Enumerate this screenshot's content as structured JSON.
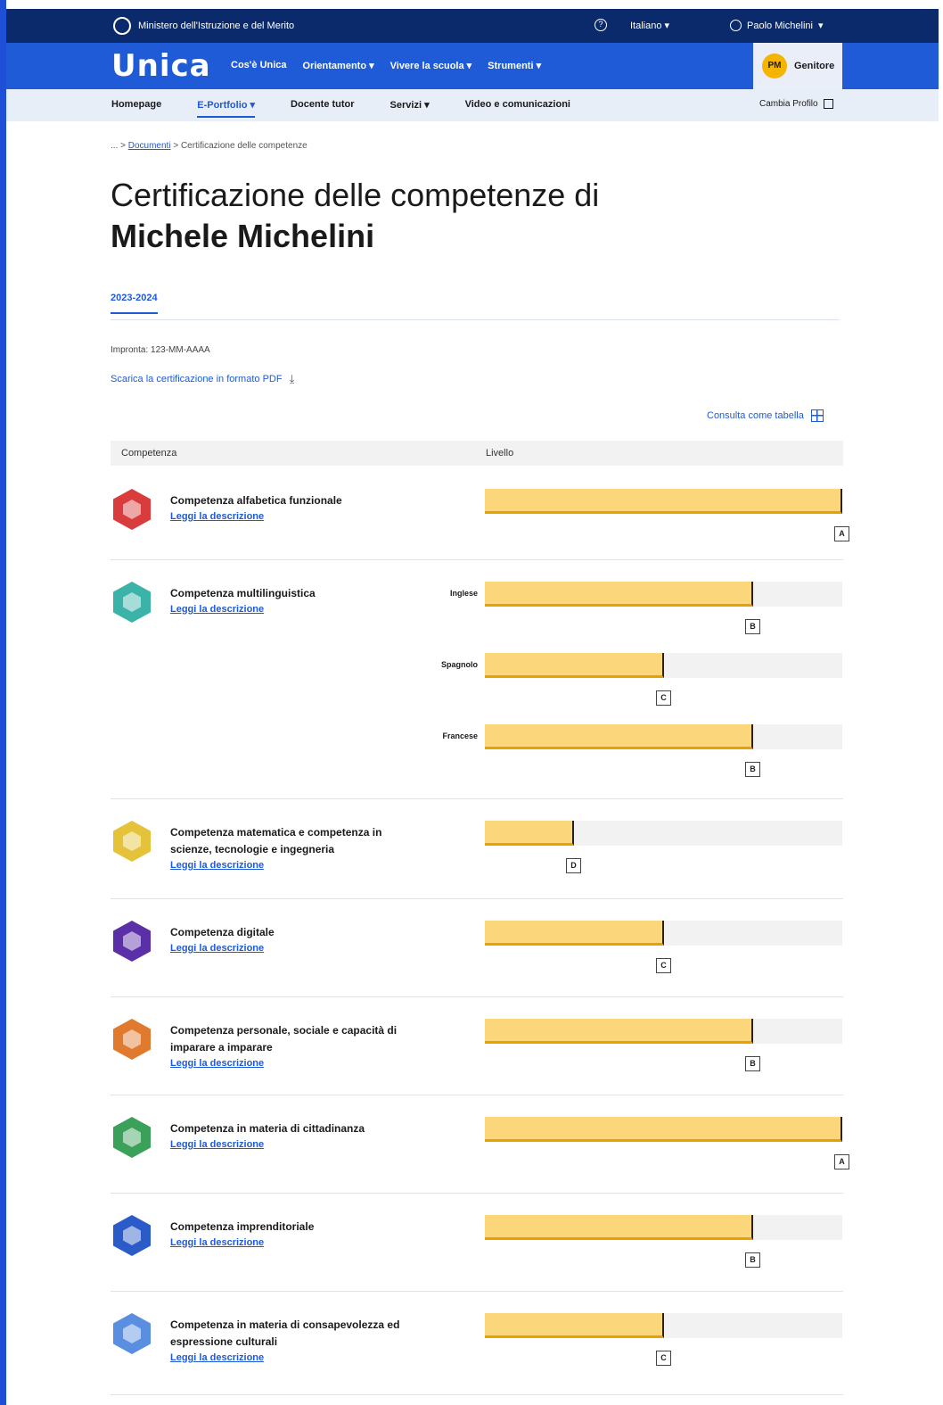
{
  "topbar": {
    "ministry": "Ministero dell'Istruzione e del Merito",
    "help": "?",
    "language": "Italiano",
    "user": "Paolo Michelini"
  },
  "mainnav": {
    "logo": "Unica",
    "links": [
      "Cos'è Unica",
      "Orientamento",
      "Vivere la scuola",
      "Strumenti"
    ],
    "profile": {
      "initials": "PM",
      "role": "Genitore"
    }
  },
  "subnav": {
    "items": [
      "Homepage",
      "E-Portfolio",
      "Docente tutor",
      "Servizi",
      "Video e comunicazioni"
    ],
    "change_profile": "Cambia Profilo"
  },
  "breadcrumb": {
    "ellipsis": "... >",
    "link": "Documenti",
    "sep": ">",
    "current": "Certificazione delle competenze"
  },
  "page": {
    "title_line1": "Certificazione delle competenze di",
    "title_name": "Michele Michelini",
    "tab": "2023-2024",
    "imprint": "Impronta: 123-MM-AAAA",
    "download": "Scarica la certificazione in formato PDF",
    "table_link": "Consulta come tabella"
  },
  "table": {
    "col_competence": "Competenza",
    "col_level": "Livello",
    "description_link": "Leggi la descrizione",
    "rows": [
      {
        "name": "Competenza alfabetica funzionale",
        "color": "#d93c3c",
        "icon": "person-icon",
        "bars": [
          {
            "lang": "",
            "level": "A",
            "fill": 1.0
          }
        ]
      },
      {
        "name": "Competenza multilinguistica",
        "color": "#3bb3a8",
        "icon": "globe-icon",
        "bars": [
          {
            "lang": "Inglese",
            "level": "B",
            "fill": 0.75
          },
          {
            "lang": "Spagnolo",
            "level": "C",
            "fill": 0.5
          },
          {
            "lang": "Francese",
            "level": "B",
            "fill": 0.75
          }
        ]
      },
      {
        "name": "Competenza matematica e competenza in scienze, tecnologie e ingegneria",
        "color": "#e4c33a",
        "icon": "atom-icon",
        "bars": [
          {
            "lang": "",
            "level": "D",
            "fill": 0.25
          }
        ]
      },
      {
        "name": "Competenza digitale",
        "color": "#5b2fa8",
        "icon": "laptop-icon",
        "bars": [
          {
            "lang": "",
            "level": "C",
            "fill": 0.5
          }
        ]
      },
      {
        "name": "Competenza personale, sociale e capacità di imparare a imparare",
        "color": "#e07a2e",
        "icon": "graduation-icon",
        "bars": [
          {
            "lang": "",
            "level": "B",
            "fill": 0.75
          }
        ]
      },
      {
        "name": "Competenza in materia di cittadinanza",
        "color": "#3aa05a",
        "icon": "citizen-icon",
        "bars": [
          {
            "lang": "",
            "level": "A",
            "fill": 1.0
          }
        ]
      },
      {
        "name": "Competenza imprenditoriale",
        "color": "#2a5bc8",
        "icon": "handshake-icon",
        "bars": [
          {
            "lang": "",
            "level": "B",
            "fill": 0.75
          }
        ]
      },
      {
        "name": "Competenza in materia di consapevolezza ed espressione culturali",
        "color": "#5a8ee0",
        "icon": "theater-icon",
        "bars": [
          {
            "lang": "",
            "level": "C",
            "fill": 0.5
          }
        ]
      }
    ]
  }
}
